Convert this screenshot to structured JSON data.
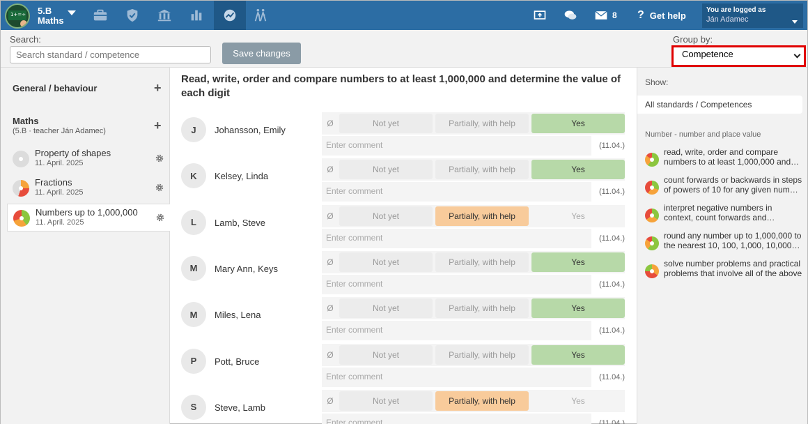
{
  "header": {
    "class_line1": "5.B",
    "class_line2": "Maths",
    "messages_count": "8",
    "help_label": "Get help",
    "user_prefix": "You are logged as",
    "user_name": "Ján Adamec",
    "brand_color": "#2c6da4"
  },
  "toolbar": {
    "search_label": "Search:",
    "search_placeholder": "Search standard / competence",
    "save_label": "Save changes",
    "groupby_label": "Group by:",
    "groupby_value": "Competence"
  },
  "sidebar": {
    "general_label": "General / behaviour",
    "subject_label": "Maths",
    "subject_sub": "(5.B · teacher Ján Adamec)",
    "items": [
      {
        "title": "Property of shapes",
        "date": "11. April. 2025",
        "dot": "conic-gradient(#dcdcdc 0 100%)"
      },
      {
        "title": "Fractions",
        "date": "11. April. 2025",
        "dot": "conic-gradient(#f6a33b 0 25%, #e74c3c 25% 55%, #dcdcdc 55% 100%)"
      },
      {
        "title": "Numbers up to 1,000,000",
        "date": "11. April. 2025",
        "dot": "conic-gradient(#8cc63f 0 40%, #f6a33b 40% 70%, #e74c3c 70% 100%)"
      }
    ]
  },
  "main": {
    "title": "Read, write, order and compare numbers to at least 1,000,000 and determine the value of each digit",
    "null_symbol": "Ø",
    "opt_notyet": "Not yet",
    "opt_partial": "Partially, with help",
    "opt_yes": "Yes",
    "comment_placeholder": "Enter comment",
    "comment_date": "(11.04.)",
    "students": [
      {
        "initial": "J",
        "name": "Johansson, Emily",
        "selected": "yes"
      },
      {
        "initial": "K",
        "name": "Kelsey, Linda",
        "selected": "yes"
      },
      {
        "initial": "L",
        "name": "Lamb, Steve",
        "selected": "partial"
      },
      {
        "initial": "M",
        "name": "Mary Ann, Keys",
        "selected": "yes"
      },
      {
        "initial": "M",
        "name": "Miles, Lena",
        "selected": "yes"
      },
      {
        "initial": "P",
        "name": "Pott, Bruce",
        "selected": "yes"
      },
      {
        "initial": "S",
        "name": "Steve, Lamb",
        "selected": "partial"
      }
    ]
  },
  "right": {
    "show_label": "Show:",
    "show_all": "All standards / Competences",
    "group_head": "Number - number and place value",
    "competences": [
      {
        "text": "read, write, order and compare\nnumbers to at least 1,000,000 and…",
        "dot": "conic-gradient(#8cc63f 0 60%, #f6a33b 60% 85%, #e74c3c 85% 100%)"
      },
      {
        "text": "count forwards or backwards in steps\nof powers of 10 for any given num…",
        "dot": "conic-gradient(#8cc63f 0 30%, #f6a33b 30% 60%, #e74c3c 60% 100%)"
      },
      {
        "text": "interpret negative numbers in\ncontext, count forwards and…",
        "dot": "conic-gradient(#8cc63f 0 35%, #f6a33b 35% 65%, #e74c3c 65% 100%)"
      },
      {
        "text": "round any number up to 1,000,000 to\nthe nearest 10, 100, 1,000, 10,000…",
        "dot": "conic-gradient(#8cc63f 0 60%, #f6a33b 60% 85%, #e74c3c 85% 100%)"
      },
      {
        "text": "solve number problems and practical\nproblems that involve all of the above",
        "dot": "conic-gradient(#f6a33b 0 35%, #e74c3c 35% 75%, #8cc63f 75% 100%)"
      }
    ]
  }
}
